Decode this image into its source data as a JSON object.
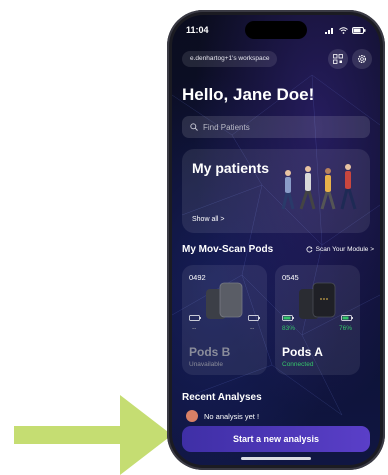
{
  "status_bar": {
    "time": "11:04"
  },
  "header": {
    "workspace": "e.denhartog+1's workspace",
    "greeting": "Hello, Jane Doe!"
  },
  "search": {
    "placeholder": "Find Patients"
  },
  "patients_card": {
    "title": "My patients",
    "link": "Show all >"
  },
  "pods_section": {
    "title": "My Mov-Scan Pods",
    "scan_label": "Scan Your Module >",
    "pods": [
      {
        "id": "0492",
        "name": "Pods B",
        "status": "Unavailable",
        "left_battery": "--",
        "right_battery": "--"
      },
      {
        "id": "0545",
        "name": "Pods A",
        "status": "Connected",
        "left_battery": "83%",
        "right_battery": "76%"
      }
    ]
  },
  "recent": {
    "title": "Recent Analyses",
    "empty_text": "No analysis yet !"
  },
  "cta": {
    "label": "Start a new analysis"
  },
  "colors": {
    "accent": "#5a3fc8",
    "connected": "#35c46a",
    "arrow": "#c5dd72"
  }
}
